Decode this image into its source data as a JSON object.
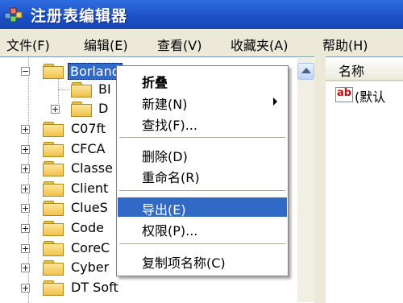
{
  "window": {
    "title": "注册表编辑器",
    "icon": "registry-editor-icon"
  },
  "menubar": [
    {
      "label": "文件(F)"
    },
    {
      "label": "编辑(E)"
    },
    {
      "label": "查看(V)"
    },
    {
      "label": "收藏夹(A)"
    },
    {
      "label": "帮助(H)"
    }
  ],
  "tree": {
    "items": [
      {
        "label": "Borland",
        "expander": "−",
        "selected": true
      },
      {
        "label": "BI",
        "expander": ""
      },
      {
        "label": "D",
        "expander": "+"
      },
      {
        "label": "C07ft",
        "expander": "+"
      },
      {
        "label": "CFCA",
        "expander": "+"
      },
      {
        "label": "Classe",
        "expander": "+"
      },
      {
        "label": "Client",
        "expander": "+"
      },
      {
        "label": "ClueS",
        "expander": "+"
      },
      {
        "label": "Code",
        "expander": "+"
      },
      {
        "label": "CoreC",
        "expander": "+"
      },
      {
        "label": "Cyber",
        "expander": "+"
      },
      {
        "label": "DT Soft",
        "expander": "+"
      }
    ]
  },
  "list": {
    "column_name": "名称",
    "rows": [
      {
        "icon": "ab",
        "name": "(默认"
      }
    ]
  },
  "context_menu": {
    "items": [
      {
        "label": "折叠"
      },
      {
        "label": "新建(N)"
      },
      {
        "label": "查找(F)..."
      },
      {
        "label": "删除(D)"
      },
      {
        "label": "重命名(R)"
      },
      {
        "label": "导出(E)"
      },
      {
        "label": "权限(P)..."
      },
      {
        "label": "复制项名称(C)"
      }
    ]
  },
  "colors": {
    "titlebar": "#1a4fc6",
    "highlight": "#316ac5",
    "folder": "#f0c24c"
  }
}
